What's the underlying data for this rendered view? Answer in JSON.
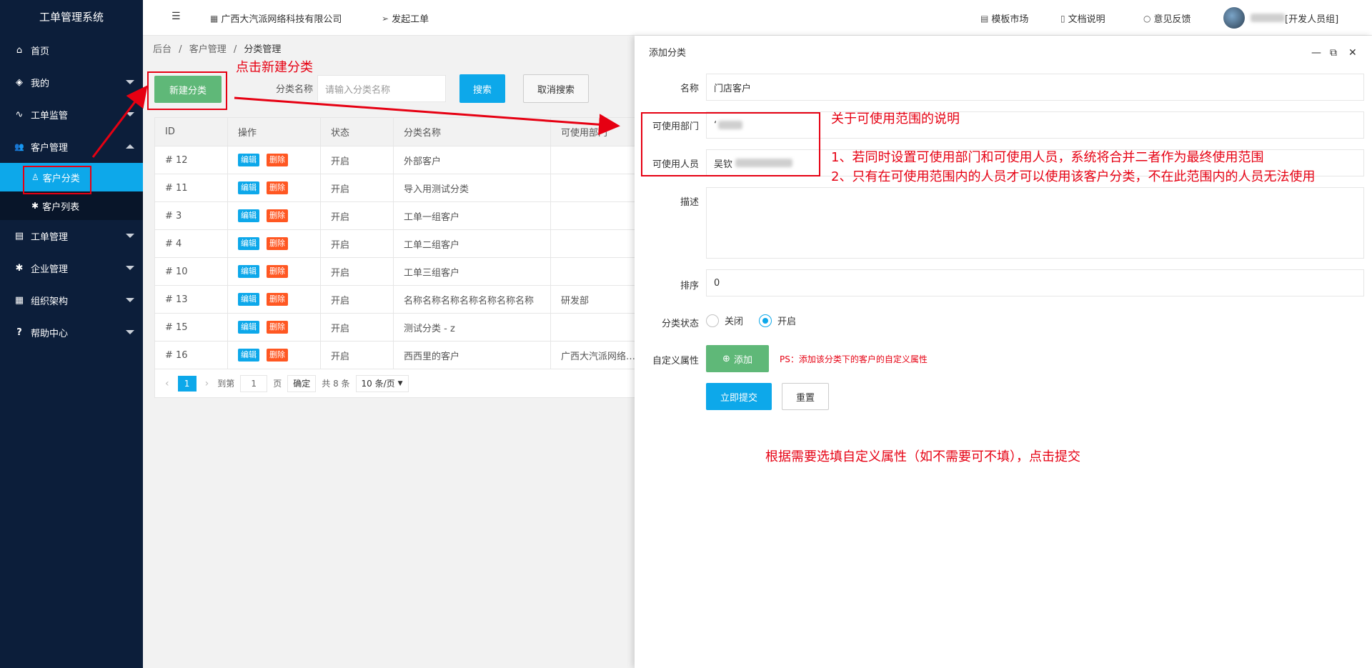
{
  "app_title": "工单管理系统",
  "sidebar": {
    "items": [
      {
        "icon": "home-icon",
        "glyph": "⌂",
        "label": "首页"
      },
      {
        "icon": "layers-icon",
        "glyph": "◈",
        "label": "我的"
      },
      {
        "icon": "pulse-icon",
        "glyph": "∿",
        "label": "工单监管"
      },
      {
        "icon": "users-icon",
        "glyph": "👥",
        "label": "客户管理"
      },
      {
        "icon": "clipboard-icon",
        "glyph": "▤",
        "label": "工单管理"
      },
      {
        "icon": "gear-icon",
        "glyph": "✱",
        "label": "企业管理"
      },
      {
        "icon": "org-icon",
        "glyph": "▦",
        "label": "组织架构"
      },
      {
        "icon": "help-icon",
        "glyph": "?",
        "label": "帮助中心"
      }
    ],
    "sub_items": [
      {
        "icon": "user-icon",
        "glyph": "♙",
        "label": "客户分类"
      },
      {
        "icon": "cog-icon",
        "glyph": "✱",
        "label": "客户列表"
      }
    ]
  },
  "header": {
    "menu_icon": "☰",
    "company": "广西大汽派网络科技有限公司",
    "new_ticket": "发起工单",
    "template_market": "模板市场",
    "docs": "文档说明",
    "feedback": "意见反馈",
    "user_group": "[开发人员组]"
  },
  "breadcrumb": {
    "root": "后台",
    "parent": "客户管理",
    "current": "分类管理",
    "sep": "/"
  },
  "toolbar": {
    "new_category": "新建分类",
    "search_label": "分类名称",
    "search_placeholder": "请输入分类名称",
    "search_button": "搜索",
    "cancel_search": "取消搜索"
  },
  "table": {
    "headers": [
      "ID",
      "操作",
      "状态",
      "分类名称",
      "可使用部门"
    ],
    "edit_label": "编辑",
    "delete_label": "删除",
    "rows": [
      {
        "id": "# 12",
        "status": "开启",
        "name": "外部客户",
        "dept": ""
      },
      {
        "id": "# 11",
        "status": "开启",
        "name": "导入用测试分类",
        "dept": ""
      },
      {
        "id": "# 3",
        "status": "开启",
        "name": "工单一组客户",
        "dept": ""
      },
      {
        "id": "# 4",
        "status": "开启",
        "name": "工单二组客户",
        "dept": ""
      },
      {
        "id": "# 10",
        "status": "开启",
        "name": "工单三组客户",
        "dept": ""
      },
      {
        "id": "# 13",
        "status": "开启",
        "name": "名称名称名称名称名称名称名称",
        "dept": "研发部"
      },
      {
        "id": "# 15",
        "status": "开启",
        "name": "测试分类 - z",
        "dept": ""
      },
      {
        "id": "# 16",
        "status": "开启",
        "name": "西西里的客户",
        "dept": "广西大汽派网络科技有限公司"
      }
    ]
  },
  "pager": {
    "current": "1",
    "goto_label": "到第",
    "goto_value": "1",
    "page_unit": "页",
    "confirm": "确定",
    "total": "共 8 条",
    "page_size": "10 条/页"
  },
  "panel": {
    "title": "添加分类",
    "name_label": "名称",
    "name_value": "门店客户",
    "dept_label": "可使用部门",
    "dept_value": "‘",
    "staff_label": "可使用人员",
    "staff_value": "吴钦",
    "desc_label": "描述",
    "sort_label": "排序",
    "sort_value": "0",
    "status_label": "分类状态",
    "status_off": "关闭",
    "status_on": "开启",
    "custom_label": "自定义属性",
    "add_button": "添加",
    "ps_note": "PS：添加该分类下的客户的自定义属性",
    "submit": "立即提交",
    "reset": "重置"
  },
  "annotations": {
    "click_new": "点击新建分类",
    "scope_title": "关于可使用范围的说明",
    "scope_line1": "1、若同时设置可使用部门和可使用人员，系统将合并二者作为最终使用范围",
    "scope_line2": "2、只有在可使用范围内的人员才可以使用该客户分类，不在此范围内的人员无法使用",
    "submit_hint": "根据需要选填自定义属性（如不需要可不填），点击提交"
  }
}
